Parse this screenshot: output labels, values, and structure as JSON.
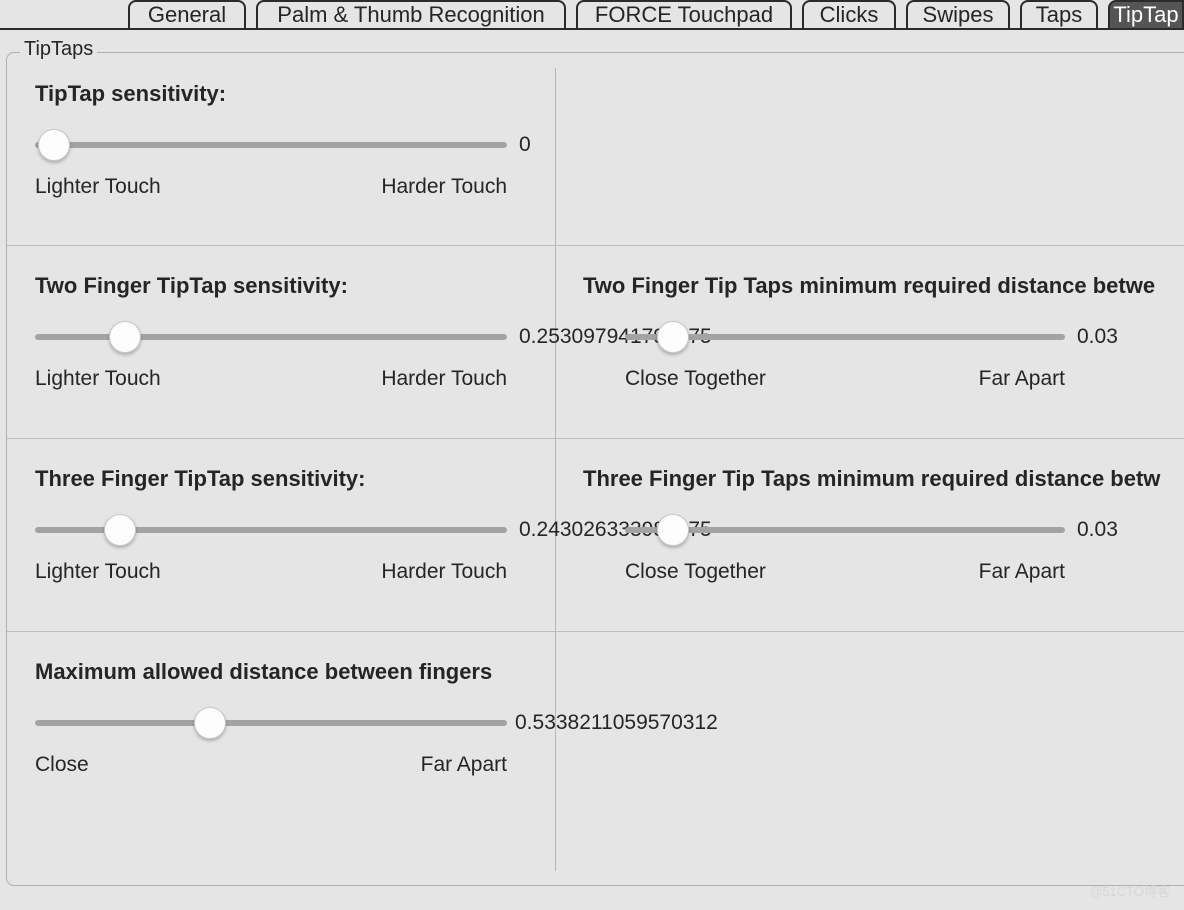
{
  "tabs": {
    "items": [
      {
        "label": "General"
      },
      {
        "label": "Palm & Thumb Recognition"
      },
      {
        "label": "FORCE Touchpad"
      },
      {
        "label": "Clicks"
      },
      {
        "label": "Swipes"
      },
      {
        "label": "Taps"
      },
      {
        "label": "TipTap"
      }
    ],
    "active_index": 6
  },
  "section_label": "TipTaps",
  "rows": {
    "tiptap_sensitivity": {
      "title": "TipTap sensitivity:",
      "value": "0",
      "thumb_pct": 4,
      "labels": {
        "left": "Lighter Touch",
        "right": "Harder Touch"
      }
    },
    "two_finger_sensitivity": {
      "title": "Two Finger TipTap sensitivity:",
      "value": "0.253097941796875",
      "thumb_pct": 19,
      "labels": {
        "left": "Lighter Touch",
        "right": "Harder Touch"
      }
    },
    "two_finger_min_distance": {
      "title": "Two Finger Tip Taps minimum required distance betwe",
      "value": "0.03",
      "thumb_pct": 11,
      "labels": {
        "left": "Close Together",
        "right": "Far Apart"
      }
    },
    "three_finger_sensitivity": {
      "title": "Three Finger TipTap sensitivity:",
      "value": "0.243026333984375",
      "thumb_pct": 18,
      "labels": {
        "left": "Lighter Touch",
        "right": "Harder Touch"
      }
    },
    "three_finger_min_distance": {
      "title": "Three Finger Tip Taps minimum required distance betw",
      "value": "0.03",
      "thumb_pct": 11,
      "labels": {
        "left": "Close Together",
        "right": "Far Apart"
      }
    },
    "max_distance": {
      "title": "Maximum allowed distance between fingers",
      "value": "0.5338211059570312",
      "thumb_pct": 37,
      "labels": {
        "left": "Close",
        "right": "Far Apart"
      }
    }
  },
  "watermark": "@51CTO博客"
}
